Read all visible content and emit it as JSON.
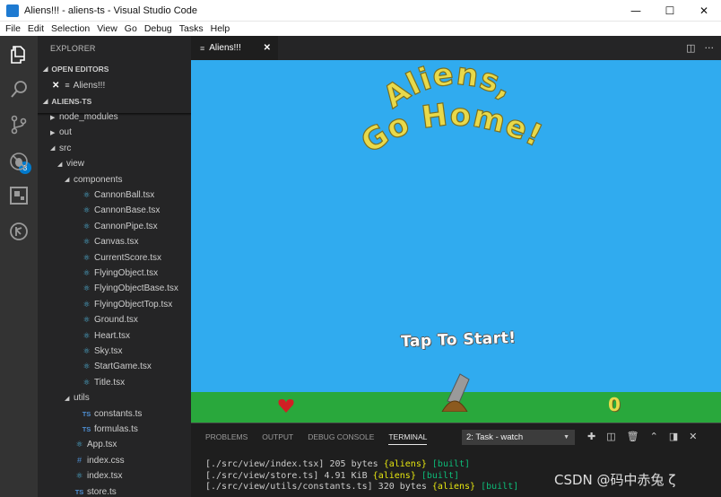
{
  "window": {
    "title": "Aliens!!! - aliens-ts - Visual Studio Code",
    "controls": [
      "—",
      "☐",
      "✕"
    ]
  },
  "menu": [
    "File",
    "Edit",
    "Selection",
    "View",
    "Go",
    "Debug",
    "Tasks",
    "Help"
  ],
  "activity_bar": {
    "icons": [
      "files-icon",
      "search-icon",
      "source-control-icon",
      "debug-icon",
      "extensions-icon",
      "git-history-icon"
    ],
    "scm_badge": "3"
  },
  "sidebar": {
    "title": "EXPLORER",
    "open_editors_header": "OPEN EDITORS",
    "open_editor": "Aliens!!!",
    "project_header": "ALIENS-TS",
    "tree": [
      {
        "label": "node_modules",
        "depth": 0,
        "kind": "folder-closed"
      },
      {
        "label": "out",
        "depth": 0,
        "kind": "folder-closed"
      },
      {
        "label": "src",
        "depth": 0,
        "kind": "folder-open"
      },
      {
        "label": "view",
        "depth": 1,
        "kind": "folder-open"
      },
      {
        "label": "components",
        "depth": 2,
        "kind": "folder-open"
      },
      {
        "label": "CannonBall.tsx",
        "depth": 3,
        "kind": "react"
      },
      {
        "label": "CannonBase.tsx",
        "depth": 3,
        "kind": "react"
      },
      {
        "label": "CannonPipe.tsx",
        "depth": 3,
        "kind": "react"
      },
      {
        "label": "Canvas.tsx",
        "depth": 3,
        "kind": "react"
      },
      {
        "label": "CurrentScore.tsx",
        "depth": 3,
        "kind": "react"
      },
      {
        "label": "FlyingObject.tsx",
        "depth": 3,
        "kind": "react"
      },
      {
        "label": "FlyingObjectBase.tsx",
        "depth": 3,
        "kind": "react"
      },
      {
        "label": "FlyingObjectTop.tsx",
        "depth": 3,
        "kind": "react"
      },
      {
        "label": "Ground.tsx",
        "depth": 3,
        "kind": "react"
      },
      {
        "label": "Heart.tsx",
        "depth": 3,
        "kind": "react"
      },
      {
        "label": "Sky.tsx",
        "depth": 3,
        "kind": "react"
      },
      {
        "label": "StartGame.tsx",
        "depth": 3,
        "kind": "react"
      },
      {
        "label": "Title.tsx",
        "depth": 3,
        "kind": "react"
      },
      {
        "label": "utils",
        "depth": 2,
        "kind": "folder-open"
      },
      {
        "label": "constants.ts",
        "depth": 3,
        "kind": "ts"
      },
      {
        "label": "formulas.ts",
        "depth": 3,
        "kind": "ts"
      },
      {
        "label": "App.tsx",
        "depth": 2,
        "kind": "react"
      },
      {
        "label": "index.css",
        "depth": 2,
        "kind": "css"
      },
      {
        "label": "index.tsx",
        "depth": 2,
        "kind": "react"
      },
      {
        "label": "store.ts",
        "depth": 2,
        "kind": "ts"
      }
    ]
  },
  "editor": {
    "tab_label": "Aliens!!!",
    "game": {
      "title_line1": "Aliens,",
      "title_line2": "Go Home!",
      "start_text": "Tap To Start!",
      "score": "0",
      "colors": {
        "sky": "#30abef",
        "ground": "#29a83c",
        "title": "#e8d94a",
        "heart": "#d11f24"
      }
    }
  },
  "panel": {
    "tabs": [
      "PROBLEMS",
      "OUTPUT",
      "DEBUG CONSOLE",
      "TERMINAL"
    ],
    "active_tab": "TERMINAL",
    "task_select": "2: Task - watch",
    "terminal_lines": [
      {
        "path": "[./src/view/index.tsx]",
        "size": "205 bytes",
        "chunk": "{aliens}",
        "status": "[built]"
      },
      {
        "path": "[./src/view/store.ts]",
        "size": "4.91 KiB",
        "chunk": "{aliens}",
        "status": "[built]"
      },
      {
        "path": "[./src/view/utils/constants.ts]",
        "size": "320 bytes",
        "chunk": "{aliens}",
        "status": "[built]"
      }
    ]
  },
  "watermark": "CSDN @码中赤兔 ζ"
}
